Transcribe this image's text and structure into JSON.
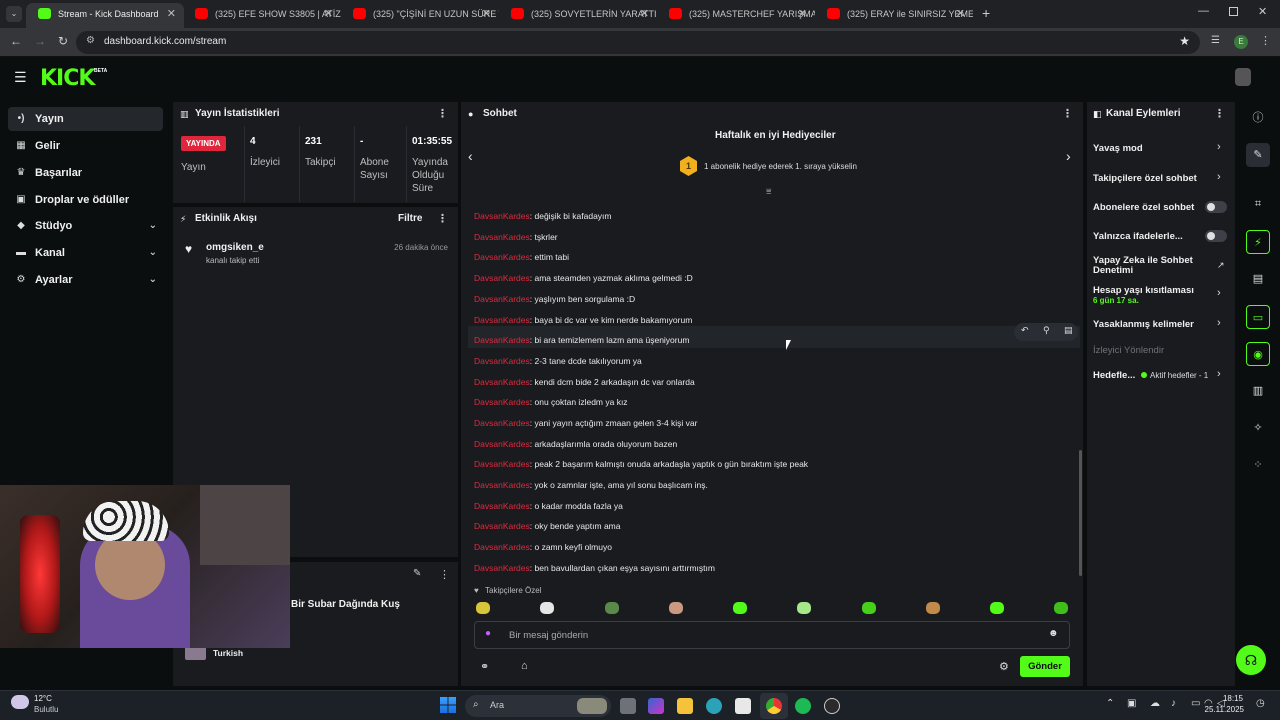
{
  "browser": {
    "tabs": [
      {
        "title": "Stream - Kick Dashboard",
        "active": true
      },
      {
        "title": "(325) EFE SHOW S3805 | ATİZ4...",
        "active": false
      },
      {
        "title": "(325) \"ÇİŞİNİ EN UZUN SÜRE T...",
        "active": false
      },
      {
        "title": "(325) SOVYETLERİN YARATTIĞI...",
        "active": false
      },
      {
        "title": "(325) MASTERCHEF YARIŞMACI...",
        "active": false
      },
      {
        "title": "(325) ERAY ile SINIRSIZ YEMEK...",
        "active": false
      }
    ],
    "url": "dashboard.kick.com/stream",
    "profile_initial": "E"
  },
  "kick": {
    "logo": "KICK",
    "beta": "BETA"
  },
  "sidebar": {
    "items": [
      {
        "label": "Yayın",
        "icon": "broadcast-icon"
      },
      {
        "label": "Gelir",
        "icon": "revenue-icon"
      },
      {
        "label": "Başarılar",
        "icon": "trophy-icon"
      },
      {
        "label": "Droplar ve ödüller",
        "icon": "gift-icon"
      },
      {
        "label": "Stüdyo",
        "icon": "studio-icon"
      },
      {
        "label": "Kanal",
        "icon": "channel-icon"
      },
      {
        "label": "Ayarlar",
        "icon": "gear-icon"
      }
    ]
  },
  "stats": {
    "title": "Yayın İstatistikleri",
    "live_badge": "YAYINDA",
    "live_label": "Yayın",
    "cells": [
      {
        "value": "4",
        "label": "İzleyici"
      },
      {
        "value": "231",
        "label": "Takipçi"
      },
      {
        "value": "-",
        "label": "Abone Sayısı"
      },
      {
        "value": "01:35:55",
        "label": "Yayında Olduğu Süre"
      }
    ]
  },
  "activity": {
    "title": "Etkinlik Akışı",
    "filter": "Filtre",
    "events": [
      {
        "user": "omgsiken_e",
        "desc": "kanalı takip etti",
        "time": "26 dakika önce"
      }
    ]
  },
  "stream_info": {
    "title": "Bir Subar Dağında Kuş",
    "language": "Turkish"
  },
  "chat": {
    "title": "Sohbet",
    "gifters_title": "Haftalık en iyi Hediyeciler",
    "gifters_rank": "1",
    "gifters_text": "1 abonelik hediye ederek 1. sıraya yükselin",
    "messages": [
      {
        "user": "DavsanKardes",
        "text": ": değişik bi kafadayım"
      },
      {
        "user": "DavsanKardes",
        "text": ": tşkrler"
      },
      {
        "user": "DavsanKardes",
        "text": ": ettim tabi"
      },
      {
        "user": "DavsanKardes",
        "text": ": ama steamden yazmak aklıma gelmedi :D"
      },
      {
        "user": "DavsanKardes",
        "text": ": yaşlıyım ben sorgulama :D"
      },
      {
        "user": "DavsanKardes",
        "text": ": baya bi dc var ve kim nerde bakamıyorum"
      },
      {
        "user": "DavsanKardes",
        "text": ": bi ara temizlemem lazm ama üşeniyorum"
      },
      {
        "user": "DavsanKardes",
        "text": ": 2-3 tane dcde takılıyorum ya"
      },
      {
        "user": "DavsanKardes",
        "text": ": kendi dcm bide 2 arkadaşın dc var onlarda"
      },
      {
        "user": "DavsanKardes",
        "text": ": onu çoktan izledm ya kız"
      },
      {
        "user": "DavsanKardes",
        "text": ": yani yayın açtığım zmaan gelen 3-4 kişi var"
      },
      {
        "user": "DavsanKardes",
        "text": ": arkadaşlarımla orada oluyorum bazen"
      },
      {
        "user": "DavsanKardes",
        "text": ": peak 2 başarım kalmıştı onuda arkadaşla yaptık o gün bıraktım işte peak"
      },
      {
        "user": "DavsanKardes",
        "text": ": yok o zamnlar işte, ama yıl sonu başlıcam inş."
      },
      {
        "user": "DavsanKardes",
        "text": ": o kadar modda fazla ya"
      },
      {
        "user": "DavsanKardes",
        "text": ": oky bende yaptım ama"
      },
      {
        "user": "DavsanKardes",
        "text": ": o zamn keyfi olmuyo"
      },
      {
        "user": "DavsanKardes",
        "text": ": ben bavullardan çıkan eşya sayısını arttırmıştım"
      }
    ],
    "followers_only": "Takipçilere Özel",
    "input_placeholder": "Bir mesaj gönderin",
    "send_label": "Gönder"
  },
  "channel_actions": {
    "title": "Kanal Eylemleri",
    "slow_mode": "Yavaş mod",
    "followers_chat": "Takipçilere özel sohbet",
    "subscribers_chat": "Abonelere özel sohbet",
    "emotes_only": "Yalnızca ifadelerle...",
    "ai_moderation": "Yapay Zeka ile Sohbet Denetimi",
    "account_age": "Hesap yaşı kısıtlaması",
    "account_age_value": "6 gün 17 sa.",
    "banned_words": "Yasaklanmış kelimeler",
    "redirect": "İzleyici Yönlendir",
    "goals": "Hedefle...",
    "goals_status": "Aktif hedefler - 1"
  },
  "taskbar": {
    "weather_temp": "12°C",
    "weather_desc": "Bulutlu",
    "search": "Ara",
    "time": "18:15",
    "date": "25.11.2025"
  },
  "colors": {
    "accent": "#53fc18",
    "live": "#e0263d",
    "chat_user": "#e02a3e",
    "panel": "#191b1f",
    "background": "#0b0e0f"
  }
}
